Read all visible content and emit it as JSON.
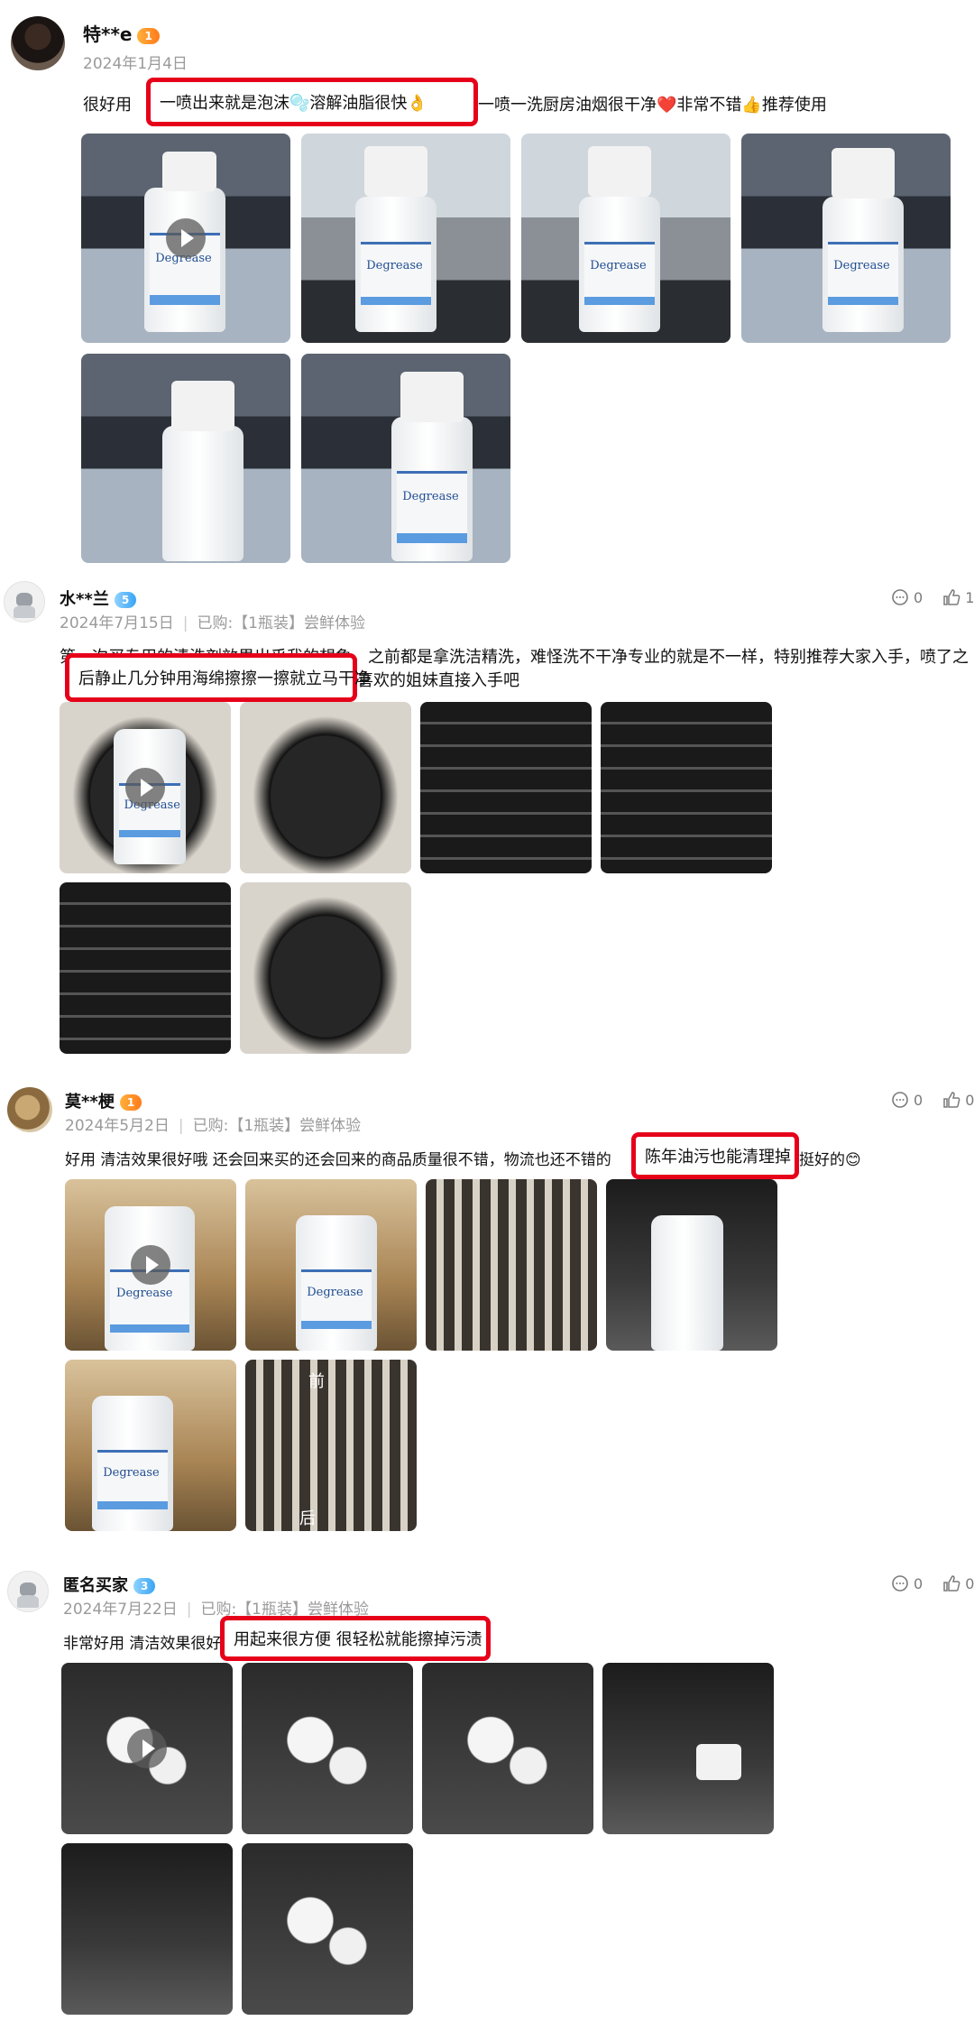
{
  "reviews": [
    {
      "username": "特**e",
      "badge": "1",
      "date": "2024年1月4日",
      "text_before": "很好用",
      "highlight": "一喷出来就是泡沫🫧溶解油脂很快👌",
      "text_after": "一喷一洗厨房油烟很干净❤️非常不错👍推荐使用"
    },
    {
      "username": "水**兰",
      "badge": "5",
      "date": "2024年7月15日",
      "purchase": "已购:【1瓶装】尝鲜体验",
      "comments": "0",
      "likes": "1",
      "line1": "第一次买专用的清洗剂效果出乎我的想象，之前都是拿洗洁精洗，难怪洗不干净专业的就是不一样，特别推荐大家入手，喷了之",
      "highlight": "后静止几分钟用海绵擦擦一擦就立马干净",
      "line2_after": "喜欢的姐妹直接入手吧"
    },
    {
      "username": "莫**梗",
      "badge": "1",
      "date": "2024年5月2日",
      "purchase": "已购:【1瓶装】尝鲜体验",
      "comments": "0",
      "likes": "0",
      "text_before": "好用 清洁效果很好哦 还会回来买的还会回来的商品质量很不错，物流也还不错的",
      "highlight": "陈年油污也能清理掉",
      "text_after": "挺好的😊",
      "caption_before": "前",
      "caption_after": "后"
    },
    {
      "username": "匿名买家",
      "badge": "3",
      "date": "2024年7月22日",
      "purchase": "已购:【1瓶装】尝鲜体验",
      "comments": "0",
      "likes": "0",
      "text_before": "非常好用 清洁效果很好",
      "highlight": "用起来很方便 很轻松就能擦掉污渍"
    }
  ],
  "product_label": "Degrease",
  "colors": {
    "highlight_border": "#e6001a",
    "meta_gray": "#9a9a9a"
  }
}
